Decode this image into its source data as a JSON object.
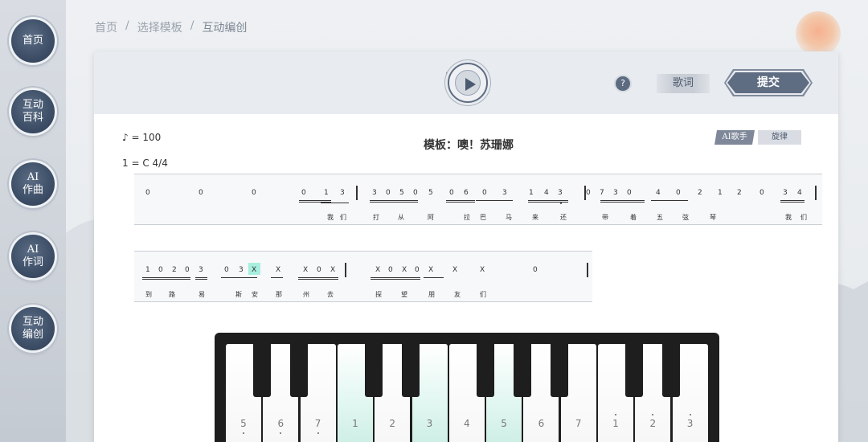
{
  "sidebar": {
    "items": [
      {
        "label": "首页"
      },
      {
        "label": "互动\n百科"
      },
      {
        "label": "AI\n作曲"
      },
      {
        "label": "AI\n作词"
      },
      {
        "label": "互动\n编创"
      }
    ]
  },
  "breadcrumb": {
    "home": "首页",
    "sep": "/",
    "templates": "选择模板",
    "current": "互动编创"
  },
  "toolbar": {
    "play_icon": "play-icon",
    "help_label": "?",
    "lyrics_label": "歌词",
    "submit_label": "提交"
  },
  "score": {
    "tempo": "♪ = 100",
    "key": "1 = C   4/4",
    "title": "模板：噢！苏珊娜",
    "ai_singer_label": "AI歌手",
    "melody_label": "旋律",
    "line1_notes": [
      "0",
      "0",
      "0",
      "0",
      "1",
      "3",
      "3",
      "0",
      "5",
      "0",
      "5",
      "0",
      "6",
      "0",
      "3",
      "1",
      "4",
      "3",
      "0",
      "7",
      "3",
      "0",
      "4",
      "0",
      "2",
      "1",
      "2",
      "0",
      "3",
      "4"
    ],
    "line1_lyrics": [
      "我",
      "们",
      "打",
      "从",
      "阿",
      "拉",
      "巴",
      "马",
      "来",
      "还",
      "带",
      "着",
      "五",
      "弦",
      "琴",
      "我",
      "们"
    ],
    "line2_notes": [
      "1",
      "0",
      "2",
      "0",
      "3",
      "0",
      "3",
      "X",
      "X",
      "X",
      "0",
      "X",
      "X",
      "0",
      "X",
      "0",
      "X",
      "X",
      "X",
      "0"
    ],
    "line2_lyrics": [
      "到",
      "路",
      "易",
      "斯",
      "安",
      "那",
      "州",
      "去",
      "探",
      "望",
      "朋",
      "友",
      "们"
    ]
  },
  "piano": {
    "keys": [
      {
        "label": "5"
      },
      {
        "label": "6"
      },
      {
        "label": "7"
      },
      {
        "label": "1"
      },
      {
        "label": "2"
      },
      {
        "label": "3"
      },
      {
        "label": "4"
      },
      {
        "label": "5"
      },
      {
        "label": "6"
      },
      {
        "label": "7"
      },
      {
        "label": "1"
      },
      {
        "label": "2"
      },
      {
        "label": "3"
      }
    ],
    "active_keys": [
      3,
      5,
      7
    ]
  },
  "colors": {
    "accent": "#5f6d83",
    "highlight": "#a8eede"
  }
}
